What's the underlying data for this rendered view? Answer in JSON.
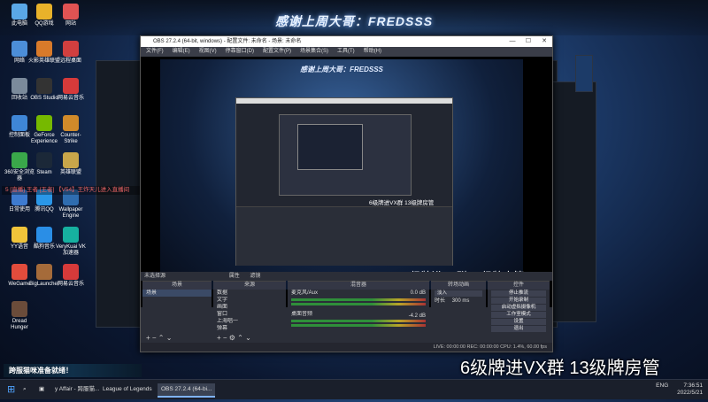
{
  "banner": {
    "title": "感谢上周大哥：FREDSSS"
  },
  "desktop_icons": [
    {
      "label": "此电脑",
      "color": "#5aa7e6"
    },
    {
      "label": "QQ游戏",
      "color": "#e8b22a"
    },
    {
      "label": "网站",
      "color": "#e05353"
    },
    {
      "label": "网络",
      "color": "#4c8ed8"
    },
    {
      "label": "火影英雄联盟",
      "color": "#d87a2a"
    },
    {
      "label": "远程桌面",
      "color": "#d13f3f"
    },
    {
      "label": "回收站",
      "color": "#7b8a9b"
    },
    {
      "label": "OBS Studio",
      "color": "#333333"
    },
    {
      "label": "网易云音乐",
      "color": "#d63a3a"
    },
    {
      "label": "控制面板",
      "color": "#3f86d6"
    },
    {
      "label": "GeForce Experience",
      "color": "#76b900"
    },
    {
      "label": "Counter-Strike",
      "color": "#d08a2a"
    },
    {
      "label": "360安全浏览器",
      "color": "#3aa84a"
    },
    {
      "label": "Steam",
      "color": "#1b2838"
    },
    {
      "label": "英雄联盟",
      "color": "#c8a64a"
    },
    {
      "label": "日常使用",
      "color": "#3e7bd0"
    },
    {
      "label": "腾讯QQ",
      "color": "#2a97e8"
    },
    {
      "label": "Wallpaper Engine",
      "color": "#2f6db0"
    },
    {
      "label": "YY语音",
      "color": "#f0c43a"
    },
    {
      "label": "酷狗音乐",
      "color": "#2a8ee6"
    },
    {
      "label": "VeryKuai VK加速器",
      "color": "#16b0a0"
    },
    {
      "label": "WeGame",
      "color": "#e24c3c"
    },
    {
      "label": "BigLauncher",
      "color": "#a56b3a"
    },
    {
      "label": "网易云音乐",
      "color": "#d63a3a"
    },
    {
      "label": "Dread Hunger",
      "color": "#6b4c3a"
    }
  ],
  "ticker": "5 [直播] 王者 [王者] 【V54】王炸天儿进入直播间",
  "obs": {
    "title": "OBS 27.2.4 (64-bit, windows) - 配置文件: 未命名 - 场景: 未命名",
    "menu": [
      "文件(F)",
      "编辑(E)",
      "视图(V)",
      "停靠窗口(D)",
      "配置文件(P)",
      "场景集合(S)",
      "工具(T)",
      "帮助(H)"
    ],
    "window_controls": [
      "—",
      "☐",
      "✕"
    ],
    "nested_banner": "感谢上周大哥：FREDSSS",
    "preview_caption_small": "6级牌进VX群 13级牌房管",
    "preview_caption": "6级牌进VX群  13级牌房管",
    "source_toolbar": [
      "属性",
      "滤镜"
    ],
    "no_source": "未选择源",
    "docks": {
      "scenes": {
        "title": "场景",
        "items": [
          "场景"
        ]
      },
      "sources": {
        "title": "来源",
        "items": [
          "数据",
          "文字",
          "画面",
          "窗口",
          "上海唱一",
          "弹幕"
        ]
      },
      "mixer": {
        "title": "混音器",
        "tracks": [
          {
            "name": "麦克风/Aux",
            "db": "0.0 dB"
          },
          {
            "name": "桌面音频",
            "db": "-4.2 dB"
          }
        ]
      },
      "transitions": {
        "title": "转场动画",
        "type": "淡入",
        "duration_label": "时长",
        "duration": "300 ms"
      },
      "controls": {
        "title": "控件",
        "buttons": [
          "停止推流",
          "开始录制",
          "启动虚拟摄像机",
          "工作室模式",
          "设置",
          "退出"
        ]
      }
    },
    "status": "LIVE: 00:00:00   REC: 00:00:00   CPU: 1.4%, 60.00 fps"
  },
  "big_caption": "6级牌进VX群  13级牌房管",
  "stream_banner": {
    "prefix": "跨服猫咪",
    "text": "跨服猫咪准备就绪！"
  },
  "taskbar": {
    "items": [
      {
        "label": "y Affair - 跨服猫..."
      },
      {
        "label": "League of Legends"
      },
      {
        "label": "OBS 27.2.4 (64-bi..."
      }
    ],
    "tray_lang": "ENG",
    "time": "7:36:51",
    "date": "2022/5/21"
  }
}
